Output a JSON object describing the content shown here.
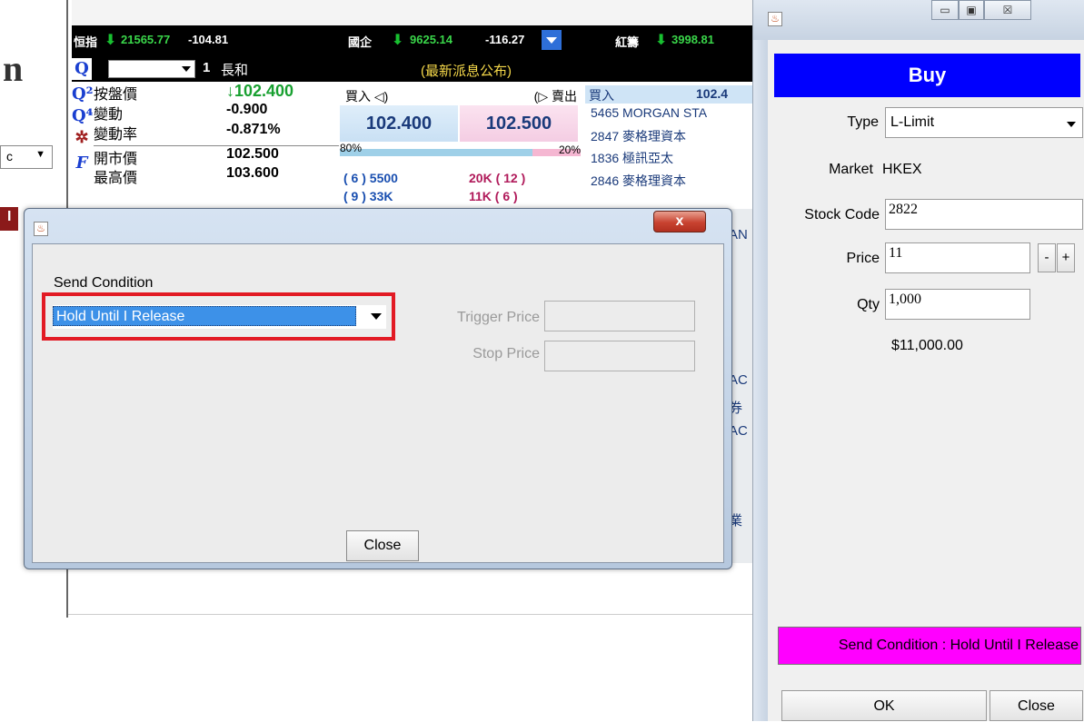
{
  "background": {
    "left_glyph": "n",
    "left_select_value": "c",
    "red_stub_text": "I"
  },
  "quote": {
    "indices": [
      {
        "name": "恒指",
        "value": "21565.77",
        "change": "-104.81"
      },
      {
        "name": "國企",
        "value": "9625.14",
        "change": "-116.27"
      },
      {
        "name": "紅籌",
        "value": "3998.81",
        "change": ""
      }
    ],
    "row_count": "1",
    "stock_name": "長和",
    "news_text": "(最新派息公布)",
    "stats": [
      {
        "label": "按盤價",
        "value": "↓102.400"
      },
      {
        "label": "變動",
        "value": "-0.900"
      },
      {
        "label": "變動率",
        "value": "-0.871%"
      },
      {
        "label": "開市價",
        "value": "102.500"
      },
      {
        "label": "最高價",
        "value": "103.600"
      }
    ],
    "bid_label": "買入 ◁)",
    "ask_label": "(▷ 賣出",
    "bid_price": "102.400",
    "ask_price": "102.500",
    "bid_pct": "80%",
    "ask_pct": "20%",
    "bid_pct_value": 80,
    "ask_pct_value": 20,
    "queue": [
      {
        "bid": "(    6 )  5500",
        "ask": "20K (   12 )"
      },
      {
        "bid": "(    9 )    33K",
        "ask": "11K (    6 )"
      }
    ],
    "broker_header_label": "買入",
    "broker_header_price": "102.4",
    "brokers": [
      "5465 MORGAN STA",
      "2847 麥格理資本",
      "1836 極訊亞太",
      "2846 麥格理資本"
    ],
    "side_fragments": [
      "AN",
      "AC",
      "券",
      "AC",
      "業"
    ]
  },
  "send_condition_dialog": {
    "close_x": "x",
    "section_label": "Send Condition",
    "selected_condition": "Hold Until I Release",
    "trigger_price_label": "Trigger Price",
    "trigger_price_value": "",
    "stop_price_label": "Stop Price",
    "stop_price_value": "",
    "close_button": "Close",
    "accent_color": "#e21a24"
  },
  "buy_window": {
    "title_buttons": [
      "▭",
      "▣",
      "☒"
    ],
    "header": "Buy",
    "header_color": "#0000ff",
    "type_label": "Type",
    "type_value": "L-Limit",
    "market_label": "Market",
    "market_value": "HKEX",
    "stock_code_label": "Stock Code",
    "stock_code_value": "2822",
    "price_label": "Price",
    "price_value": "11",
    "minus": "-",
    "plus": "+",
    "qty_label": "Qty",
    "qty_value": "1,000",
    "total": "$11,000.00",
    "send_condition_button": "Send Condition : Hold Until I Release",
    "send_condition_color": "#ff00ff",
    "ok_button": "OK",
    "close_button": "Close"
  }
}
